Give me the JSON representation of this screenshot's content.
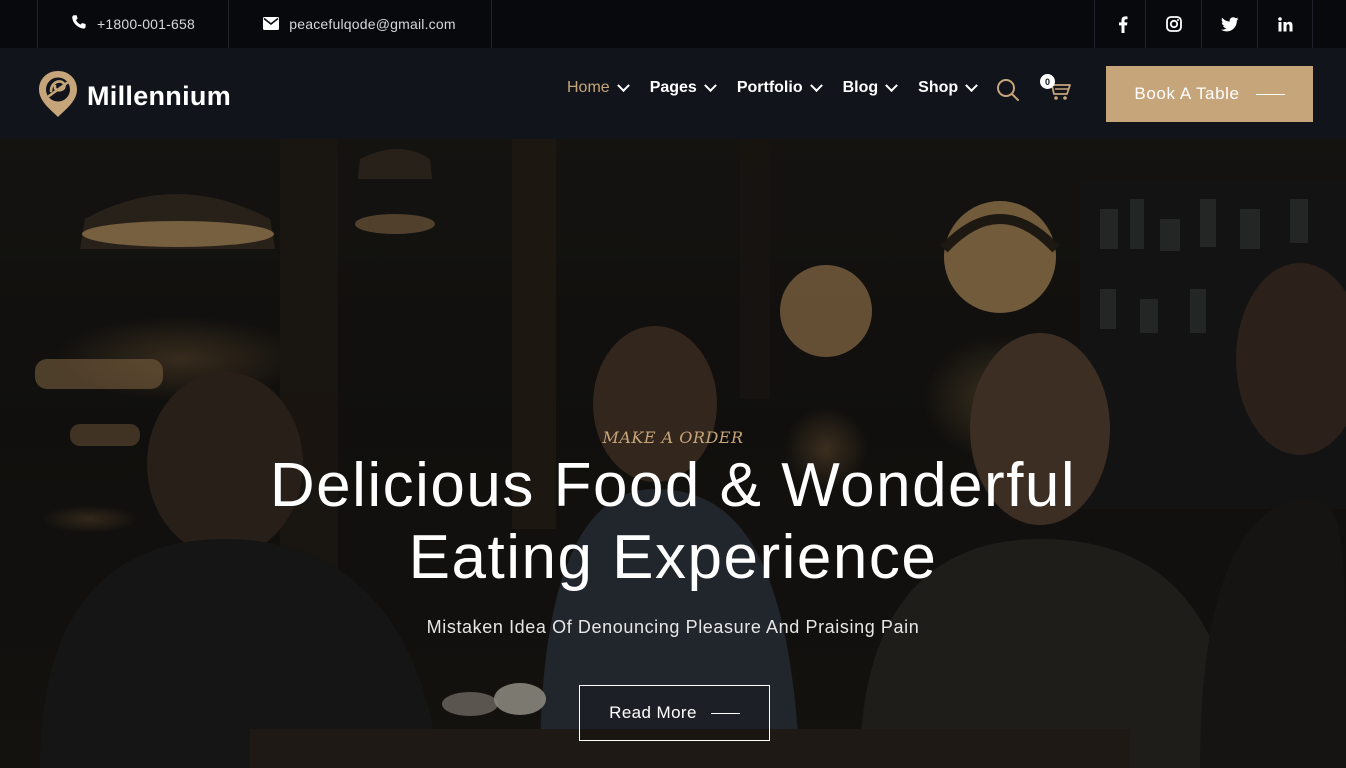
{
  "topbar": {
    "phone": "+1800-001-658",
    "email": "peacefulqode@gmail.com",
    "social": [
      {
        "icon": "facebook-icon"
      },
      {
        "icon": "instagram-icon"
      },
      {
        "icon": "twitter-icon"
      },
      {
        "icon": "linkedin-icon"
      }
    ]
  },
  "nav": {
    "logo_text": "Millennium",
    "items": [
      {
        "label": "Home",
        "active": true
      },
      {
        "label": "Pages"
      },
      {
        "label": "Portfolio"
      },
      {
        "label": "Blog"
      },
      {
        "label": "Shop"
      }
    ],
    "cart_count": "0",
    "book_label": "Book A Table"
  },
  "hero": {
    "tagline": "MAKE A ORDER",
    "title_line1": "Delicious Food & Wonderful",
    "title_line2": "Eating Experience",
    "subtitle": "Mistaken Idea Of Denouncing Pleasure And Praising Pain",
    "button_label": "Read More"
  },
  "colors": {
    "accent": "#c6a57a",
    "topbar_bg": "#07090d",
    "nav_bg": "#11141b"
  }
}
